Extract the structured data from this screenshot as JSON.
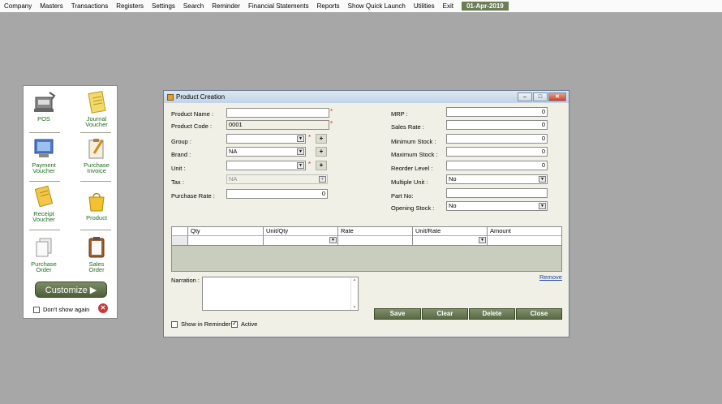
{
  "menu": {
    "items": [
      "Company",
      "Masters",
      "Transactions",
      "Registers",
      "Settings",
      "Search",
      "Reminder",
      "Financial Statements",
      "Reports",
      "Show Quick Launch",
      "Utilities",
      "Exit"
    ],
    "date": "01-Apr-2019"
  },
  "quick_launch": {
    "items": [
      {
        "label1": "POS",
        "label2": "",
        "icon": "cash-register-icon"
      },
      {
        "label1": "Journal",
        "label2": "Voucher",
        "icon": "notepad-icon"
      },
      {
        "label1": "Payment",
        "label2": "Voucher",
        "icon": "monitor-icon"
      },
      {
        "label1": "Purchase",
        "label2": "Invoice",
        "icon": "clipboard-pen-icon"
      },
      {
        "label1": "Receipt",
        "label2": "Voucher",
        "icon": "receipt-icon"
      },
      {
        "label1": "Product",
        "label2": "",
        "icon": "shopping-bag-icon"
      },
      {
        "label1": "Purchase",
        "label2": "Order",
        "icon": "documents-icon"
      },
      {
        "label1": "Sales",
        "label2": "Order",
        "icon": "clipboard-icon"
      }
    ],
    "customize_label": "Customize",
    "dont_show_label": "Don't show again"
  },
  "window": {
    "title": "Product Creation",
    "fields": {
      "product_name": {
        "label": "Product Name :",
        "value": ""
      },
      "product_code": {
        "label": "Product Code :",
        "value": "0001"
      },
      "group": {
        "label": "Group :",
        "value": ""
      },
      "brand": {
        "label": "Brand :",
        "value": "NA"
      },
      "unit": {
        "label": "Unit :",
        "value": ""
      },
      "tax": {
        "label": "Tax :",
        "value": "NA"
      },
      "purchase_rate": {
        "label": "Purchase Rate :",
        "value": "0"
      },
      "mrp": {
        "label": "MRP :",
        "value": "0"
      },
      "sales_rate": {
        "label": "Sales Rate :",
        "value": "0"
      },
      "minimum_stock": {
        "label": "Minimum Stock :",
        "value": "0"
      },
      "maximum_stock": {
        "label": "Maximum Stock :",
        "value": "0"
      },
      "reorder_level": {
        "label": "Reorder Level :",
        "value": "0"
      },
      "multiple_unit": {
        "label": "Multiple Unit :",
        "value": "No"
      },
      "part_no": {
        "label": "Part No:",
        "value": ""
      },
      "opening_stock": {
        "label": "Opening Stock :",
        "value": "No"
      }
    },
    "grid": {
      "columns": [
        "Qty",
        "Unit/Qty",
        "Rate",
        "Unit/Rate",
        "Amount"
      ]
    },
    "remove_label": "Remove",
    "narration_label": "Narration :",
    "buttons": {
      "save": "Save",
      "clear": "Clear",
      "delete": "Delete",
      "close": "Close"
    },
    "show_in_reminder": "Show in Reminder",
    "active": "Active",
    "required_mark": "*",
    "plus_label": "+"
  }
}
